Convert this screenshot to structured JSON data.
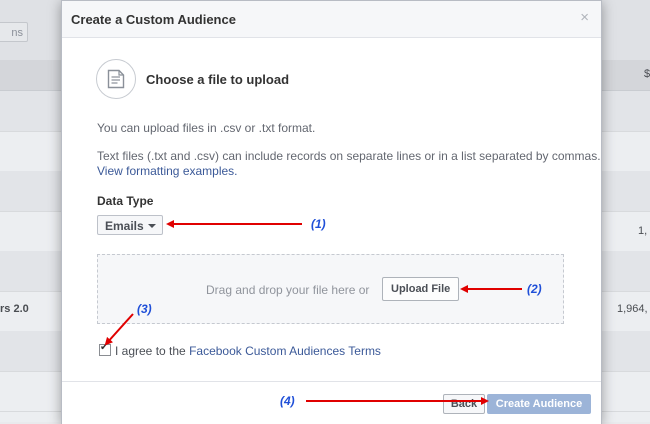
{
  "background": {
    "button_label": "ns",
    "row_text": "rs 2.0",
    "right_values": [
      "1,",
      "1,964,"
    ],
    "header_right": "$"
  },
  "modal": {
    "title": "Create a Custom Audience",
    "close_glyph": "×",
    "section_title": "Choose a file to upload",
    "format_text": "You can upload files in .csv or .txt format.",
    "records_text": "Text files (.txt and .csv) can include records on separate lines or in a list separated by commas.",
    "formatting_link": "View formatting examples.",
    "data_type_label": "Data Type",
    "data_type_value": "Emails",
    "dropzone_text": "Drag and drop your file here or",
    "upload_button": "Upload File",
    "agree_prefix": "I agree to the",
    "agree_link": "Facebook Custom Audiences Terms",
    "agree_checked": true,
    "back_button": "Back",
    "create_button": "Create Audience"
  },
  "annotations": [
    "(1)",
    "(2)",
    "(3)",
    "(4)"
  ],
  "colors": {
    "link": "#3b5998",
    "primary_disabled": "#9cb4d8",
    "arrow": "#e00000",
    "annotation": "#1f4fd8"
  }
}
